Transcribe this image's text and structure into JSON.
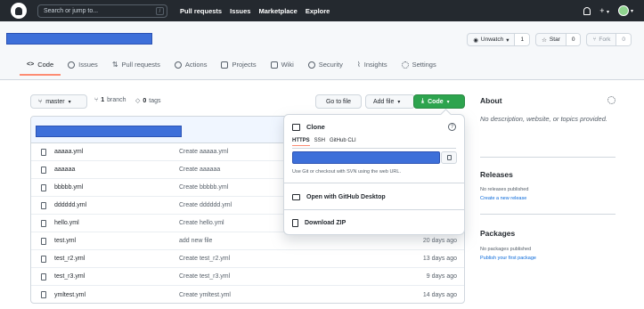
{
  "header": {
    "search_placeholder": "Search or jump to...",
    "search_shortcut": "/",
    "nav": [
      "Pull requests",
      "Issues",
      "Marketplace",
      "Explore"
    ],
    "plus": "+"
  },
  "repo": {
    "watch_label": "Unwatch",
    "watch_count": "1",
    "star_label": "Star",
    "star_count": "0",
    "fork_label": "Fork",
    "fork_count": "0",
    "tabs": [
      "Code",
      "Issues",
      "Pull requests",
      "Actions",
      "Projects",
      "Wiki",
      "Security",
      "Insights",
      "Settings"
    ]
  },
  "toolbar": {
    "branch": "master",
    "branch_count": "1",
    "branch_label": "branch",
    "tag_count": "0",
    "tag_label": "tags",
    "goto_file": "Go to file",
    "add_file": "Add file",
    "code": "Code"
  },
  "files": [
    {
      "name": "aaaaa.yml",
      "message": "Create aaaaa.yml",
      "age": ""
    },
    {
      "name": "aaaaaa",
      "message": "Create aaaaaa",
      "age": ""
    },
    {
      "name": "bbbbb.yml",
      "message": "Create bbbbb.yml",
      "age": ""
    },
    {
      "name": "dddddd.yml",
      "message": "Create dddddd.yml",
      "age": ""
    },
    {
      "name": "hello.yml",
      "message": "Create hello.yml",
      "age": ""
    },
    {
      "name": "test.yml",
      "message": "add new file",
      "age": "20 days ago"
    },
    {
      "name": "test_r2.yml",
      "message": "Create test_r2.yml",
      "age": "13 days ago"
    },
    {
      "name": "test_r3.yml",
      "message": "Create test_r3.yml",
      "age": "9 days ago"
    },
    {
      "name": "ymltest.yml",
      "message": "Create ymltest.yml",
      "age": "14 days ago"
    }
  ],
  "clone": {
    "title": "Clone",
    "help": "?",
    "tabs": [
      "HTTPS",
      "SSH",
      "GitHub CLI"
    ],
    "hint": "Use Git or checkout with SVN using the web URL.",
    "open_desktop": "Open with GitHub Desktop",
    "download_zip": "Download ZIP"
  },
  "sidebar": {
    "about_title": "About",
    "about_desc": "No description, website, or topics provided.",
    "releases_title": "Releases",
    "releases_none": "No releases published",
    "releases_link": "Create a new release",
    "packages_title": "Packages",
    "packages_none": "No packages published",
    "packages_link": "Publish your first package"
  },
  "colors": {
    "header_bg": "#24292f",
    "code_button": "#2da44e",
    "redaction": "#3d6fd9",
    "active_tab_underline": "#fd8c73",
    "link": "#0969da"
  }
}
